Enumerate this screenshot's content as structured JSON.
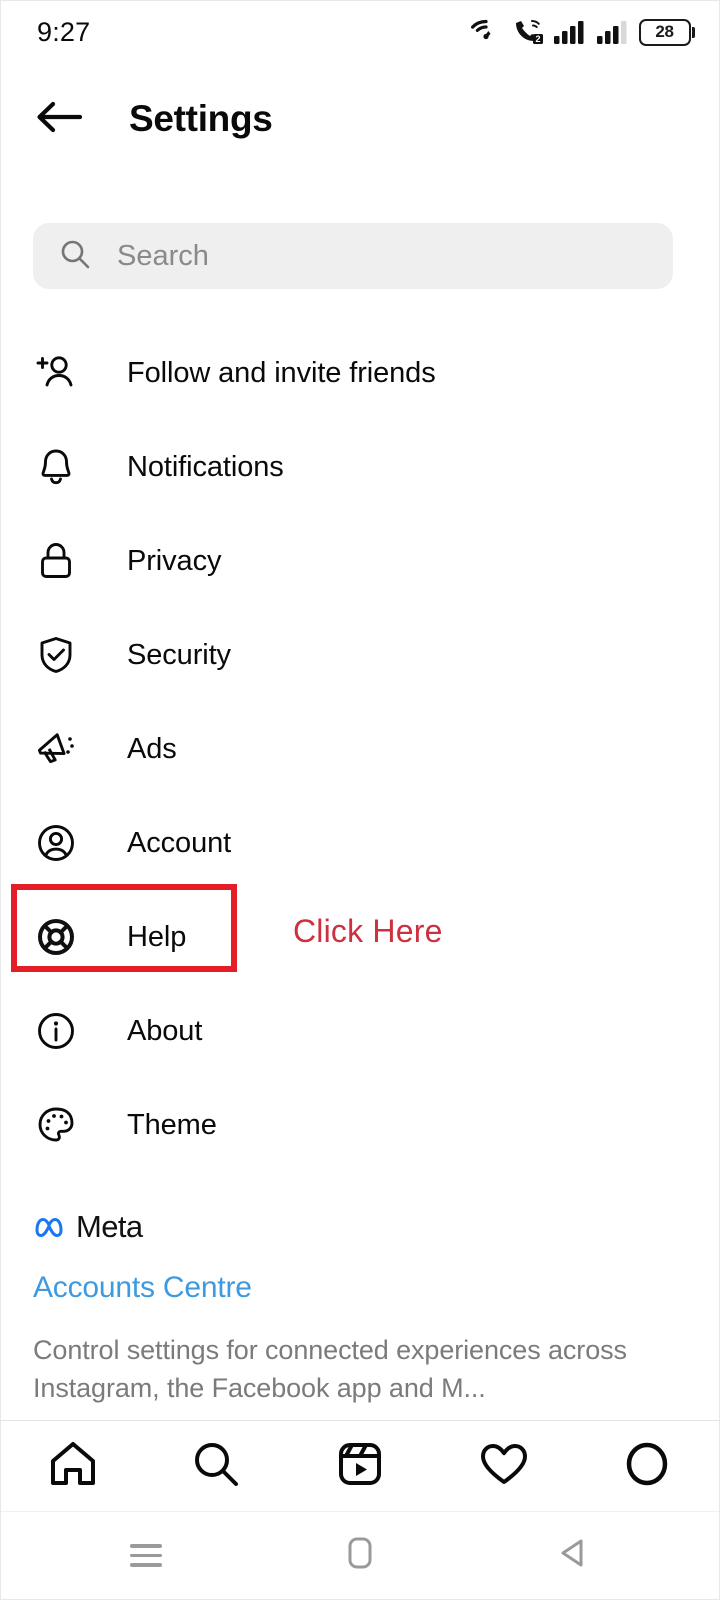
{
  "status_bar": {
    "time": "9:27",
    "battery_level": "28",
    "icons": [
      "wifi-icon",
      "call-forward-icon",
      "signal-bars-sim1-icon",
      "signal-bars-sim2-icon",
      "battery-icon"
    ],
    "sim_badge": "2"
  },
  "app_bar": {
    "back_label": "Back",
    "title": "Settings"
  },
  "search": {
    "placeholder": "Search",
    "value": "",
    "icon": "search-icon"
  },
  "menu": {
    "items": [
      {
        "label": "Follow and invite friends",
        "icon": "person-add-icon"
      },
      {
        "label": "Notifications",
        "icon": "bell-icon"
      },
      {
        "label": "Privacy",
        "icon": "lock-icon"
      },
      {
        "label": "Security",
        "icon": "shield-check-icon"
      },
      {
        "label": "Ads",
        "icon": "megaphone-icon"
      },
      {
        "label": "Account",
        "icon": "user-circle-icon"
      },
      {
        "label": "Help",
        "icon": "lifebuoy-icon"
      },
      {
        "label": "About",
        "icon": "info-circle-icon"
      },
      {
        "label": "Theme",
        "icon": "palette-icon"
      }
    ]
  },
  "annotation": {
    "callout_text": "Click Here",
    "box_color": "#e31e26",
    "text_color": "#cf3040",
    "target": "Help"
  },
  "meta_section": {
    "brand": "Meta",
    "brand_icon": "meta-infinity-logo",
    "brand_color": "#1877f2",
    "link": "Accounts Centre",
    "link_color": "#3e9ae0",
    "description": "Control settings for connected experiences across Instagram, the Facebook app and M..."
  },
  "tab_bar": {
    "tabs": [
      {
        "name": "home",
        "icon": "home-icon"
      },
      {
        "name": "search",
        "icon": "search-icon"
      },
      {
        "name": "reels",
        "icon": "reels-icon"
      },
      {
        "name": "activity",
        "icon": "heart-icon"
      },
      {
        "name": "profile",
        "icon": "profile-circle-icon"
      }
    ]
  },
  "system_nav": {
    "buttons": [
      {
        "name": "recents",
        "icon": "menu-lines-icon"
      },
      {
        "name": "home",
        "icon": "rounded-square-icon"
      },
      {
        "name": "back",
        "icon": "triangle-back-icon"
      }
    ]
  }
}
